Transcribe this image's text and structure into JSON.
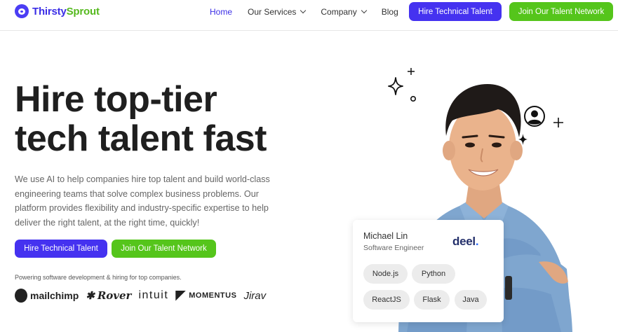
{
  "nav": {
    "brand_part1": "Thirsty",
    "brand_part2": "Sprout",
    "links": [
      {
        "label": "Home"
      },
      {
        "label": "Our Services"
      },
      {
        "label": "Company"
      },
      {
        "label": "Blog"
      }
    ],
    "hire_button": "Hire Technical Talent",
    "join_button": "Join Our Talent Network"
  },
  "hero": {
    "title_line1": "Hire top-tier",
    "title_line2": "tech talent fast",
    "description": "We use AI to help companies hire top talent and build world-class engineering teams that solve complex business problems. Our platform provides flexibility and industry-specific expertise to help deliver the right talent, at the right time, quickly!",
    "hire_button": "Hire Technical Talent",
    "join_button": "Join Our Talent Network"
  },
  "trust": {
    "caption": "Powering software development & hiring for top companies.",
    "logos": [
      "mailchimp",
      "Rover",
      "intuit",
      "MOMENTUS",
      "Jirav"
    ]
  },
  "profile_card": {
    "name": "Michael Lin",
    "role": "Software Engineer",
    "company_logo": "deel",
    "company_logo_dot": ".",
    "skills": [
      "Node.js",
      "Python",
      "ReactJS",
      "Flask",
      "Java"
    ]
  },
  "colors": {
    "primary_purple": "#4532f0",
    "accent_green": "#55c51b",
    "brand_green": "#56b91f"
  }
}
